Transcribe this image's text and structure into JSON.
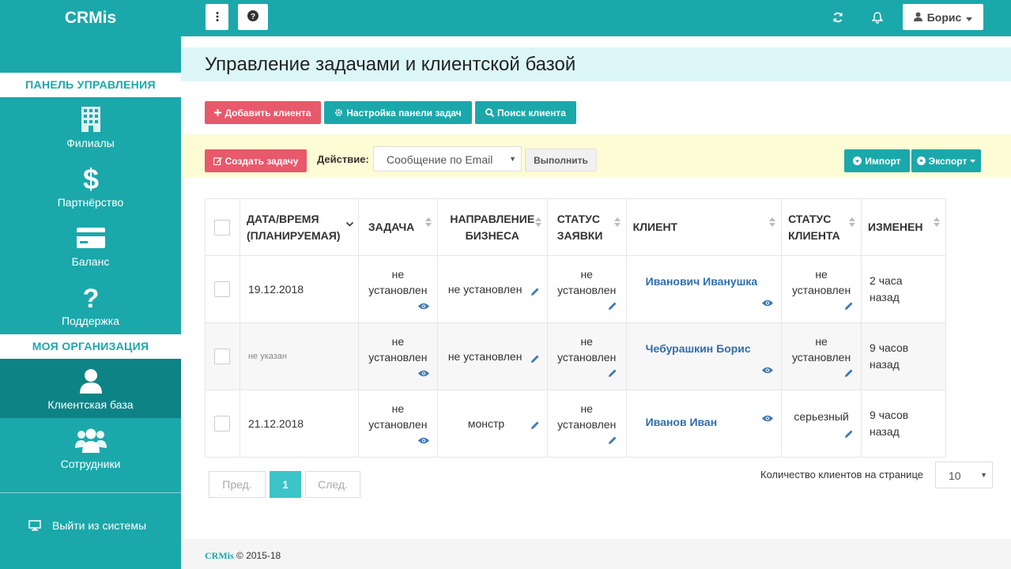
{
  "app": {
    "brand": "CRMis"
  },
  "sidebar": {
    "sections": [
      {
        "title": "ПАНЕЛЬ УПРАВЛЕНИЯ"
      },
      {
        "title": "МОЯ ОРГАНИЗАЦИЯ"
      }
    ],
    "items": [
      {
        "label": "Филиалы",
        "icon": "building-icon"
      },
      {
        "label": "Партнёрство",
        "icon": "dollar-icon"
      },
      {
        "label": "Баланс",
        "icon": "credit-card-icon"
      },
      {
        "label": "Поддержка",
        "icon": "question-icon"
      },
      {
        "label": "Клиентская база",
        "icon": "user-icon",
        "active": true
      },
      {
        "label": "Сотрудники",
        "icon": "users-icon"
      }
    ],
    "logout": "Выйти из системы"
  },
  "topbar": {
    "user_name": "Борис"
  },
  "page": {
    "title": "Управление задачами и клиентской базой"
  },
  "toolbar": {
    "add_client": "Добавить клиента",
    "task_settings": "Настройка панели задач",
    "search_client": "Поиск клиента"
  },
  "action_bar": {
    "create_task": "Создать задачу",
    "action_label": "Действие:",
    "action_select": "Сообщение по Email",
    "execute": "Выполнить",
    "import": "Импорт",
    "export": "Экспорт"
  },
  "table": {
    "headers": {
      "datetime": "ДАТА/ВРЕМЯ",
      "datetime_sub": "(ПЛАНИРУЕМАЯ)",
      "task": "ЗАДАЧА",
      "direction": "НАПРАВЛЕНИЕ",
      "direction_sub": "БИЗНЕСА",
      "req_status": "СТАТУС",
      "req_status_sub": "ЗАЯВКИ",
      "client": "КЛИЕНТ",
      "client_status": "СТАТУС",
      "client_status_sub": "КЛИЕНТА",
      "changed": "ИЗМЕНЕН"
    },
    "rows": [
      {
        "date": "19.12.2018",
        "task_1": "не",
        "task_2": "установлен",
        "direction": "не установлен",
        "req_status_1": "не",
        "req_status_2": "установлен",
        "client": "Иванович Иванушка",
        "client_status_1": "не",
        "client_status_2": "установлен",
        "changed_1": "2 часа",
        "changed_2": "назад"
      },
      {
        "date": "не указан",
        "task_1": "не",
        "task_2": "установлен",
        "direction": "не установлен",
        "req_status_1": "не",
        "req_status_2": "установлен",
        "client": "Чебурашкин Борис",
        "client_status_1": "не",
        "client_status_2": "установлен",
        "changed_1": "9 часов",
        "changed_2": "назад"
      },
      {
        "date": "21.12.2018",
        "task_1": "не",
        "task_2": "установлен",
        "direction": "монстр",
        "req_status_1": "не",
        "req_status_2": "установлен",
        "client": "Иванов Иван",
        "client_status_1": "серьезный",
        "client_status_2": "",
        "changed_1": "9 часов",
        "changed_2": "назад"
      }
    ]
  },
  "pagination": {
    "prev": "Пред.",
    "current": "1",
    "next": "След.",
    "per_page_label": "Количество клиентов на странице",
    "per_page_value": "10"
  },
  "footer": {
    "brand": "CRMis",
    "copyright": "© 2015-18"
  },
  "colors": {
    "primary": "#1ba8ab",
    "danger": "#e8596b",
    "link": "#2f6fae"
  }
}
